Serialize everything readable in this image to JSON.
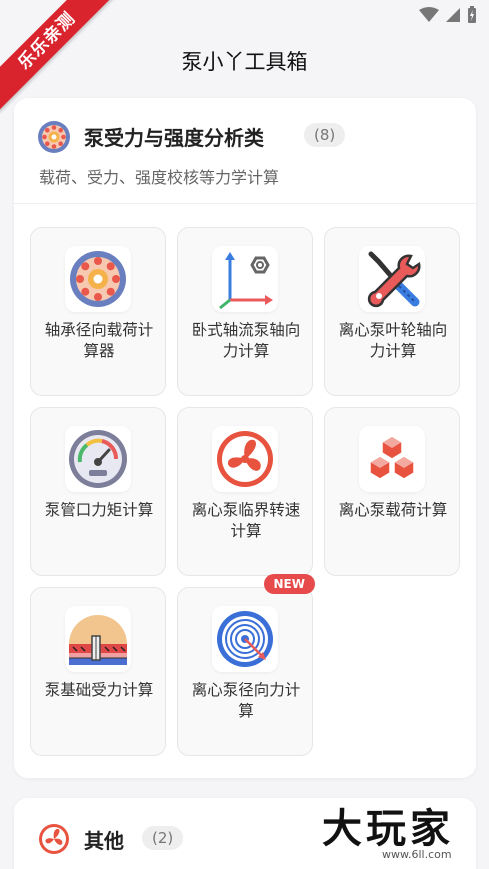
{
  "status_bar": {
    "icons": [
      "wifi-icon",
      "signal-icon",
      "battery-charging-icon"
    ]
  },
  "ribbon": {
    "text": "乐乐亲测"
  },
  "app": {
    "title": "泵小丫工具箱"
  },
  "category": {
    "title": "泵受力与强度分析类",
    "count": "(8)",
    "description": "载荷、受力、强度校核等力学计算",
    "tools": [
      {
        "label": "轴承径向载荷计算器",
        "icon": "bearing-icon",
        "new": false
      },
      {
        "label": "卧式轴流泵轴向力计算",
        "icon": "axis-force-icon",
        "new": false
      },
      {
        "label": "离心泵叶轮轴向力计算",
        "icon": "wrench-screwdriver-icon",
        "new": false
      },
      {
        "label": "泵管口力矩计算",
        "icon": "gauge-icon",
        "new": false
      },
      {
        "label": "离心泵临界转速计算",
        "icon": "fan-icon",
        "new": false
      },
      {
        "label": "离心泵载荷计算",
        "icon": "cubes-icon",
        "new": false
      },
      {
        "label": "泵基础受力计算",
        "icon": "foundation-icon",
        "new": false
      },
      {
        "label": "离心泵径向力计算",
        "icon": "target-icon",
        "new": true,
        "badge": "NEW"
      }
    ]
  },
  "other": {
    "title": "其他",
    "count": "(2)",
    "icon": "fan-icon"
  },
  "watermark": {
    "text": "大玩家",
    "sub": "www.6ll.com"
  },
  "colors": {
    "accent": "#e74c3c",
    "ribbon": "#d9232d",
    "badge": "#e74a4a"
  }
}
